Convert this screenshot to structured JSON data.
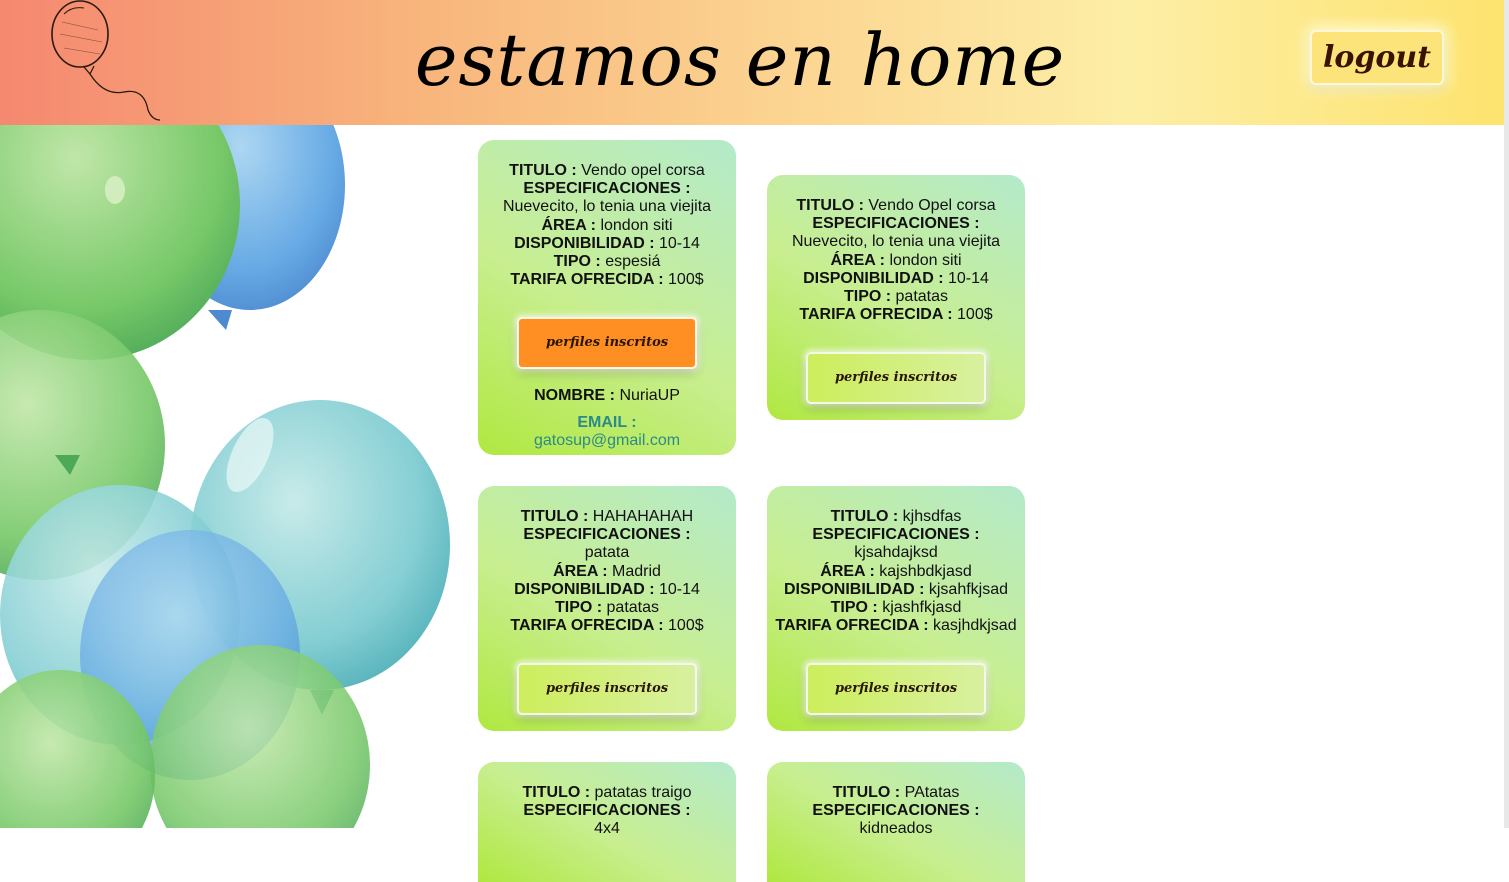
{
  "header": {
    "title": "estamos en home",
    "logout_label": "logout",
    "balloon_icon": "balloon-sketch-icon"
  },
  "labels": {
    "titulo": "TITULO :",
    "especificaciones": "ESPECIFICACIONES :",
    "area": "ÁREA :",
    "disponibilidad": "DISPONIBILIDAD :",
    "tipo": "TIPO :",
    "tarifa": "TARIFA OFRECIDA :",
    "nombre": "NOMBRE :",
    "email": "EMAIL :",
    "profiles_button": "perfiles inscritos"
  },
  "cards": [
    {
      "titulo": "Vendo opel corsa",
      "especificaciones": "Nuevecito, lo tenia una viejita",
      "area": "london siti",
      "disponibilidad": "10-14",
      "tipo": "espesiá",
      "tarifa": "100$",
      "inscrito": {
        "nombre": "NuriaUP",
        "email": "gatosup@gmail.com"
      }
    },
    {
      "titulo": "Vendo Opel corsa",
      "especificaciones": "Nuevecito, lo tenia una viejita",
      "area": "london siti",
      "disponibilidad": "10-14",
      "tipo": "patatas",
      "tarifa": "100$"
    },
    {
      "titulo": "HAHAHAHAH",
      "especificaciones": "patata",
      "area": "Madrid",
      "disponibilidad": "10-14",
      "tipo": "patatas",
      "tarifa": "100$"
    },
    {
      "titulo": "kjhsdfas",
      "especificaciones": "kjsahdajksd",
      "area": "kajshbdkjasd",
      "disponibilidad": "kjsahfkjsad",
      "tipo": "kjashfkjasd",
      "tarifa": "kasjhdkjsad"
    },
    {
      "titulo": "patatas traigo",
      "especificaciones": "4x4"
    },
    {
      "titulo": "PAtatas",
      "especificaciones": "kidneados"
    }
  ],
  "colors": {
    "header_left": "#f58870",
    "header_right": "#fde36e",
    "card_green": "#b0e840",
    "card_mint": "#b4eaca",
    "active_button": "#ff8f22",
    "email_teal": "#2b8a8a"
  }
}
